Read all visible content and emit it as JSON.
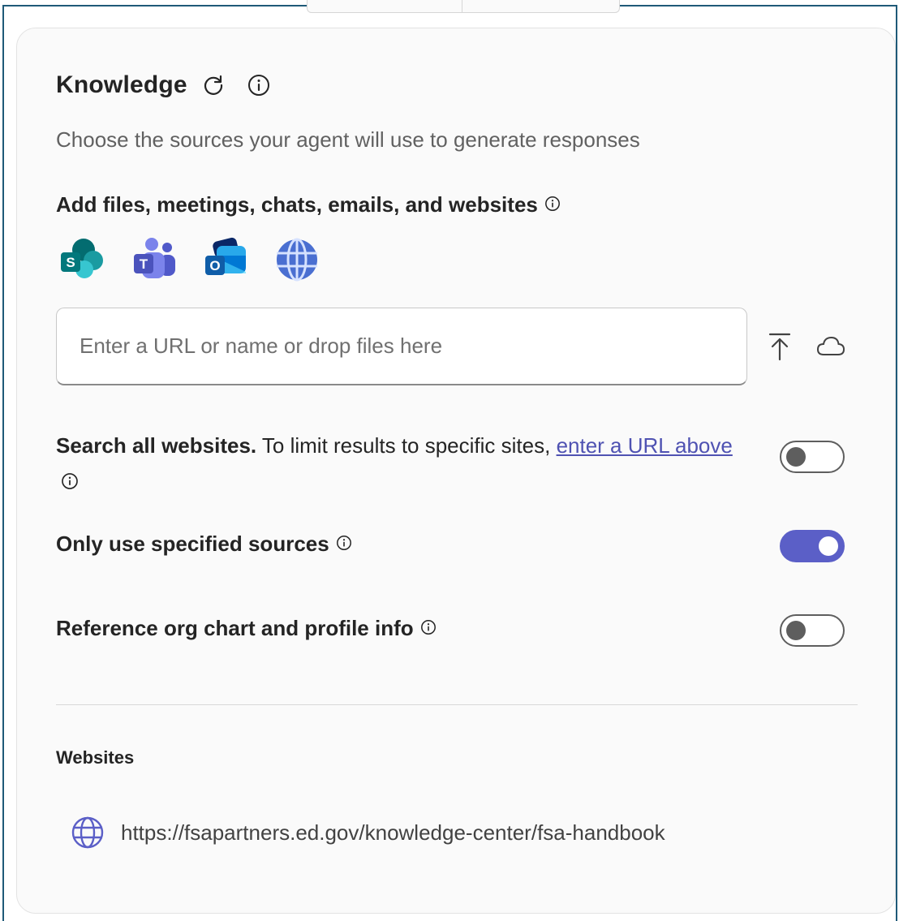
{
  "knowledge": {
    "title": "Knowledge",
    "subtitle": "Choose the sources your agent will use to generate responses",
    "add_sources_label": "Add files, meetings, chats, emails, and websites",
    "sources": [
      {
        "name": "sharepoint",
        "letter": "S"
      },
      {
        "name": "teams",
        "letter": "T"
      },
      {
        "name": "outlook",
        "letter": "O"
      },
      {
        "name": "web",
        "letter": ""
      }
    ],
    "input": {
      "placeholder": "Enter a URL or name or drop files here",
      "value": ""
    },
    "options": {
      "search_all_bold": "Search all websites.",
      "search_all_text": " To limit results to specific sites, ",
      "search_all_link": "enter a URL above",
      "search_all_on": false,
      "only_specified_label": "Only use specified sources",
      "only_specified_on": true,
      "org_chart_label": "Reference org chart and profile info",
      "org_chart_on": false
    },
    "websites": {
      "heading": "Websites",
      "items": [
        {
          "url": "https://fsapartners.ed.gov/knowledge-center/fsa-handbook"
        }
      ]
    }
  },
  "colors": {
    "accent": "#5b5fc7",
    "link": "#4f52b2",
    "text_primary": "#242424",
    "text_secondary": "#616161"
  }
}
